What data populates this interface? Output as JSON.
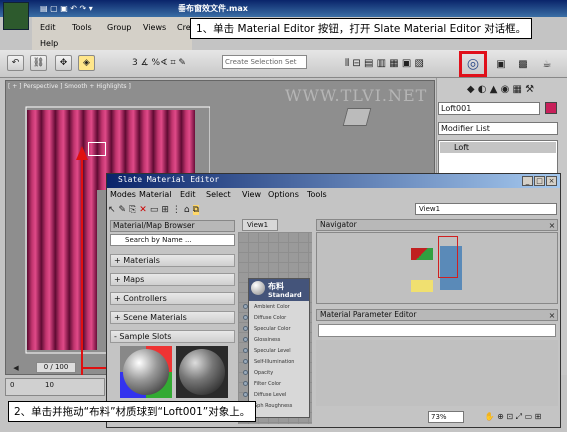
{
  "window": {
    "title": "垂布窗效文件.max"
  },
  "menu": {
    "row1": [
      "Edit",
      "Tools",
      "Group",
      "Views",
      "Cre"
    ],
    "row2": [
      "Help"
    ]
  },
  "toolbar": {
    "all_dropdown": "All",
    "create_selection_set_placeholder": "Create Selection Set"
  },
  "callouts": {
    "step1": "1、单击 Material Editor 按钮，打开 Slate Material Editor 对话框。",
    "step2": "2、单击并拖动“布料”材质球到“Loft001”对象上。"
  },
  "viewport": {
    "label": "[ + ] Perspective ] Smooth + Highlights ]",
    "watermark": "WWW.TLVI.NET"
  },
  "command_panel": {
    "object_name": "Loft001",
    "modifier_list": "Modifier List",
    "stack_item": "Loft"
  },
  "slate": {
    "title": "Slate Material Editor",
    "menu": [
      "Modes",
      "Material",
      "Edit",
      "Select",
      "View",
      "Options",
      "Tools"
    ],
    "view_dropdown": "View1",
    "browser_title": "Material/Map Browser",
    "search_placeholder": "Search by Name ...",
    "rollouts": [
      "+ Materials",
      "+ Maps",
      "+ Controllers",
      "+ Scene Materials",
      "- Sample Slots"
    ],
    "view_tab": "View1",
    "navigator_title": "Navigator",
    "param_editor_title": "Material Parameter Editor",
    "node": {
      "name": "布料",
      "type": "Standard",
      "slots": [
        "Ambient Color",
        "Diffuse Color",
        "Specular Color",
        "Glossiness",
        "Specular Level",
        "Self-Illumination",
        "Opacity",
        "Filter Color",
        "Diffuse Level",
        "Sph Roughness"
      ]
    },
    "zoom": "73%"
  },
  "time": {
    "frame": "0 / 100",
    "ticks": [
      "0",
      "10"
    ]
  }
}
